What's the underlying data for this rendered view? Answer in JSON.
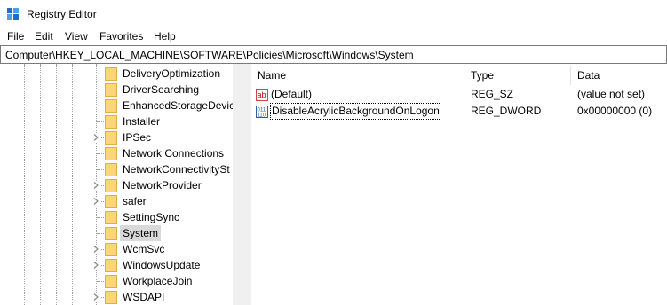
{
  "window": {
    "title": "Registry Editor"
  },
  "menu": [
    "File",
    "Edit",
    "View",
    "Favorites",
    "Help"
  ],
  "address": {
    "path": "Computer\\HKEY_LOCAL_MACHINE\\SOFTWARE\\Policies\\Microsoft\\Windows\\System"
  },
  "tree": {
    "items": [
      {
        "label": "DeliveryOptimization",
        "expandable": false,
        "selected": false
      },
      {
        "label": "DriverSearching",
        "expandable": false,
        "selected": false
      },
      {
        "label": "EnhancedStorageDevic",
        "expandable": false,
        "selected": false
      },
      {
        "label": "Installer",
        "expandable": false,
        "selected": false
      },
      {
        "label": "IPSec",
        "expandable": true,
        "selected": false
      },
      {
        "label": "Network Connections",
        "expandable": false,
        "selected": false
      },
      {
        "label": "NetworkConnectivitySt",
        "expandable": false,
        "selected": false
      },
      {
        "label": "NetworkProvider",
        "expandable": true,
        "selected": false
      },
      {
        "label": "safer",
        "expandable": true,
        "selected": false
      },
      {
        "label": "SettingSync",
        "expandable": false,
        "selected": false
      },
      {
        "label": "System",
        "expandable": false,
        "selected": true
      },
      {
        "label": "WcmSvc",
        "expandable": true,
        "selected": false
      },
      {
        "label": "WindowsUpdate",
        "expandable": true,
        "selected": false
      },
      {
        "label": "WorkplaceJoin",
        "expandable": false,
        "selected": false
      },
      {
        "label": "WSDAPI",
        "expandable": true,
        "selected": false
      }
    ]
  },
  "list": {
    "columns": {
      "name": "Name",
      "type": "Type",
      "data": "Data"
    },
    "rows": [
      {
        "icon": "string-value-icon",
        "name": "(Default)",
        "type": "REG_SZ",
        "data": "(value not set)",
        "focused": false
      },
      {
        "icon": "dword-value-icon",
        "name": "DisableAcrylicBackgroundOnLogon",
        "type": "REG_DWORD",
        "data": "0x00000000 (0)",
        "focused": true
      }
    ]
  },
  "colors": {
    "folder": "#f8d775",
    "folderEdge": "#dcb046",
    "selection": "#d9d9d9",
    "appIcon": "#1e6fc8"
  }
}
